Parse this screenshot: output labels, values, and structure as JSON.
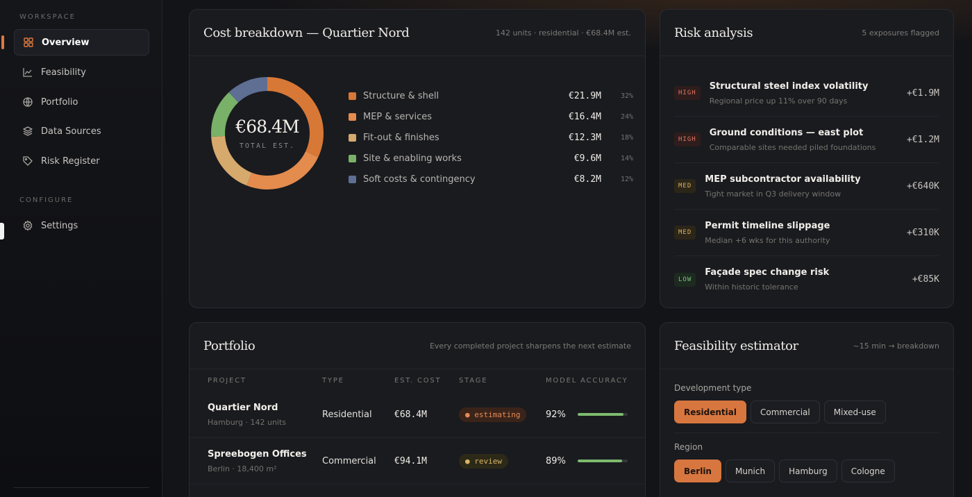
{
  "sidebar": {
    "workspace_label": "WORKSPACE",
    "configure_label": "CONFIGURE",
    "items": [
      {
        "label": "Overview",
        "icon": "grid-icon",
        "active": true
      },
      {
        "label": "Feasibility",
        "icon": "chart-line-icon"
      },
      {
        "label": "Portfolio",
        "icon": "globe-icon"
      },
      {
        "label": "Data Sources",
        "icon": "layers-icon"
      },
      {
        "label": "Risk Register",
        "icon": "tag-icon"
      }
    ],
    "settings_label": "Settings"
  },
  "cost": {
    "title": "Cost breakdown — Quartier Nord",
    "meta": "142 units · residential · €68.4M est.",
    "total": "€68.4M",
    "total_label": "TOTAL EST.",
    "items": [
      {
        "label": "Structure & shell",
        "value": "€21.9M",
        "pct": "32%",
        "share": 32,
        "color": "#d87836"
      },
      {
        "label": "MEP & services",
        "value": "€16.4M",
        "pct": "24%",
        "share": 24,
        "color": "#e48b4e"
      },
      {
        "label": "Fit-out & finishes",
        "value": "€12.3M",
        "pct": "18%",
        "share": 18,
        "color": "#d6a96d"
      },
      {
        "label": "Site & enabling works",
        "value": "€9.6M",
        "pct": "14%",
        "share": 14,
        "color": "#79b168"
      },
      {
        "label": "Soft costs & contingency",
        "value": "€8.2M",
        "pct": "12%",
        "share": 12,
        "color": "#5e6f93"
      }
    ]
  },
  "risk": {
    "title": "Risk analysis",
    "meta": "5 exposures flagged",
    "items": [
      {
        "level": "HIGH",
        "title": "Structural steel index volatility",
        "sub": "Regional price up 11% over 90 days",
        "amount": "+€1.9M"
      },
      {
        "level": "HIGH",
        "title": "Ground conditions — east plot",
        "sub": "Comparable sites needed piled foundations",
        "amount": "+€1.2M"
      },
      {
        "level": "MED",
        "title": "MEP subcontractor availability",
        "sub": "Tight market in Q3 delivery window",
        "amount": "+€640K"
      },
      {
        "level": "MED",
        "title": "Permit timeline slippage",
        "sub": "Median +6 wks for this authority",
        "amount": "+€310K"
      },
      {
        "level": "LOW",
        "title": "Façade spec change risk",
        "sub": "Within historic tolerance",
        "amount": "+€85K"
      }
    ]
  },
  "portfolio": {
    "title": "Portfolio",
    "meta": "Every completed project sharpens the next estimate",
    "columns": [
      "PROJECT",
      "TYPE",
      "EST. COST",
      "STAGE",
      "MODEL ACCURACY"
    ],
    "rows": [
      {
        "name": "Quartier Nord",
        "sub": "Hamburg · 142 units",
        "type": "Residential",
        "cost": "€68.4M",
        "stage": "estimating",
        "accuracy": "92%",
        "accuracy_value": 0.92
      },
      {
        "name": "Spreebogen Offices",
        "sub": "Berlin · 18,400 m²",
        "type": "Commercial",
        "cost": "€94.1M",
        "stage": "review",
        "accuracy": "89%",
        "accuracy_value": 0.89
      }
    ]
  },
  "feasibility": {
    "title": "Feasibility estimator",
    "meta": "~15 min → breakdown",
    "dev_label": "Development type",
    "dev_options": [
      "Residential",
      "Commercial",
      "Mixed-use"
    ],
    "region_label": "Region",
    "region_options": [
      "Berlin",
      "Munich",
      "Hamburg",
      "Cologne"
    ]
  }
}
